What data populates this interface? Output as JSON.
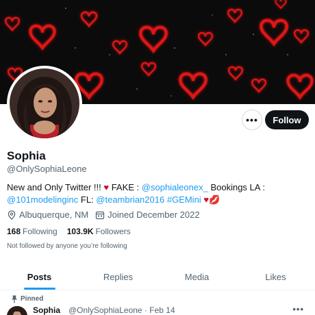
{
  "profile": {
    "name": "Sophia",
    "handle": "@OnlySophiaLeone",
    "follow_label": "Follow",
    "more_label": "•••",
    "bio": {
      "text1": "New and Only Twitter !!! ",
      "heart": "♥",
      "text2": " FAKE : ",
      "link1": "@sophialeonex_",
      "text3": " Bookings LA :",
      "link2": "@101modelinginc",
      "text4": " FL: ",
      "link3": "@teambrian2016",
      "text5": " ",
      "link4": "#GEMini",
      "text6": " ",
      "heart2": "♥",
      "kiss": "💋"
    },
    "location": "Albuquerque, NM",
    "joined": "Joined December 2022",
    "following_count": "168",
    "following_label": "Following",
    "followers_count": "103.9K",
    "followers_label": "Followers",
    "not_followed": "Not followed by anyone you’re following"
  },
  "tabs": [
    {
      "label": "Posts",
      "active": true
    },
    {
      "label": "Replies",
      "active": false
    },
    {
      "label": "Media",
      "active": false
    },
    {
      "label": "Likes",
      "active": false
    }
  ],
  "pinned_tweet": {
    "pinned_label": "Pinned",
    "name": "Sophia",
    "handle_date": "@OnlySophiaLeone · Feb 14",
    "more_label": "•••"
  },
  "colors": {
    "accent": "#1d9bf0",
    "banner_bg": "#0b0b0b",
    "banner_heart": "#e01818",
    "text": "#0f1419",
    "muted": "#536471"
  },
  "icons": {
    "location": "location-pin-icon",
    "calendar": "calendar-icon",
    "pin": "pin-icon",
    "more": "ellipsis-icon"
  }
}
